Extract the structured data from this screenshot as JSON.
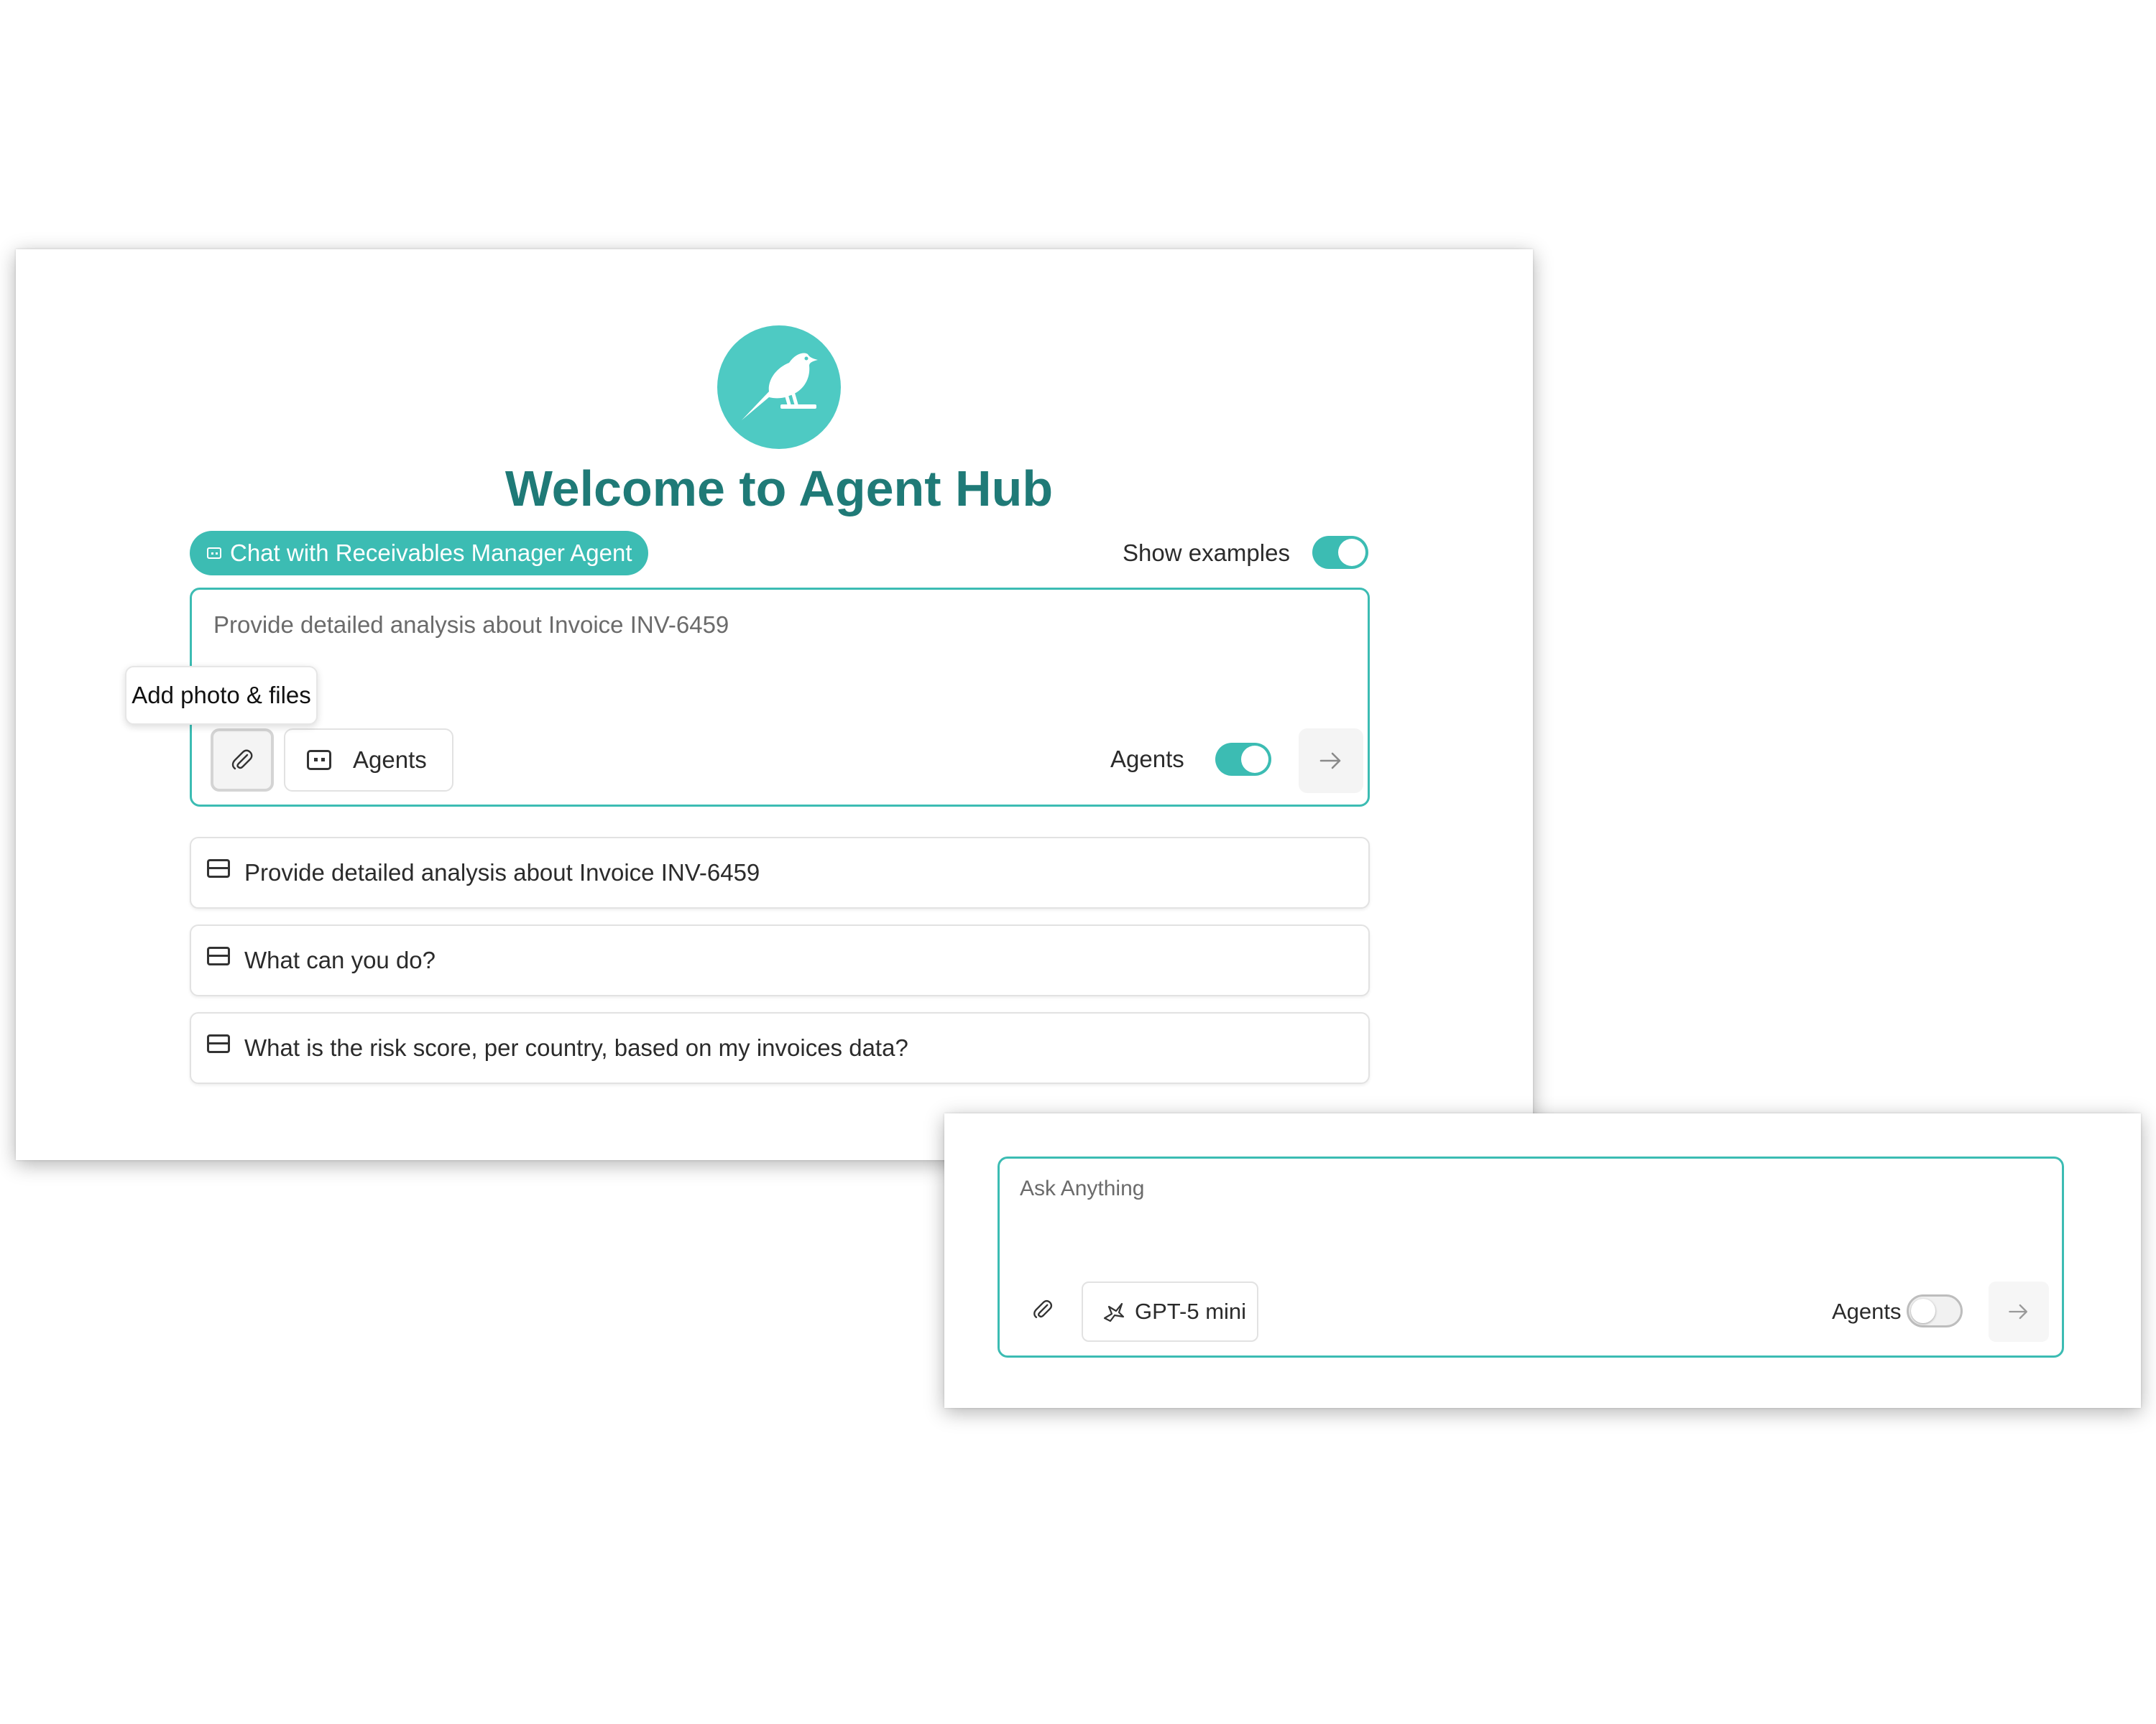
{
  "main": {
    "title": "Welcome to Agent Hub",
    "agent_chip_label": "Chat with Receivables Manager Agent",
    "show_examples_label": "Show examples",
    "show_examples_on": true,
    "input_placeholder": "Provide detailed analysis about Invoice INV-6459",
    "tooltip": "Add photo & files",
    "agents_button_label": "Agents",
    "agents_toggle_label": "Agents",
    "agents_toggle_on": true,
    "examples": [
      {
        "text": "Provide detailed analysis about Invoice INV-6459",
        "icon": "briefcase-icon"
      },
      {
        "text": "What can you do?",
        "icon": "briefcase-icon"
      },
      {
        "text": "What is the risk score, per country, based on my invoices data?",
        "icon": "briefcase-icon"
      }
    ]
  },
  "secondary": {
    "input_placeholder": "Ask Anything",
    "model_label": "GPT-5 mini",
    "agents_toggle_label": "Agents",
    "agents_toggle_on": false
  },
  "colors": {
    "accent": "#3cbcb3",
    "logo_bg": "#4ecac3",
    "title": "#1f7a77"
  },
  "icons": [
    "bird-logo",
    "agent-icon",
    "paperclip-icon",
    "arrow-right-icon",
    "briefcase-icon",
    "model-icon"
  ]
}
